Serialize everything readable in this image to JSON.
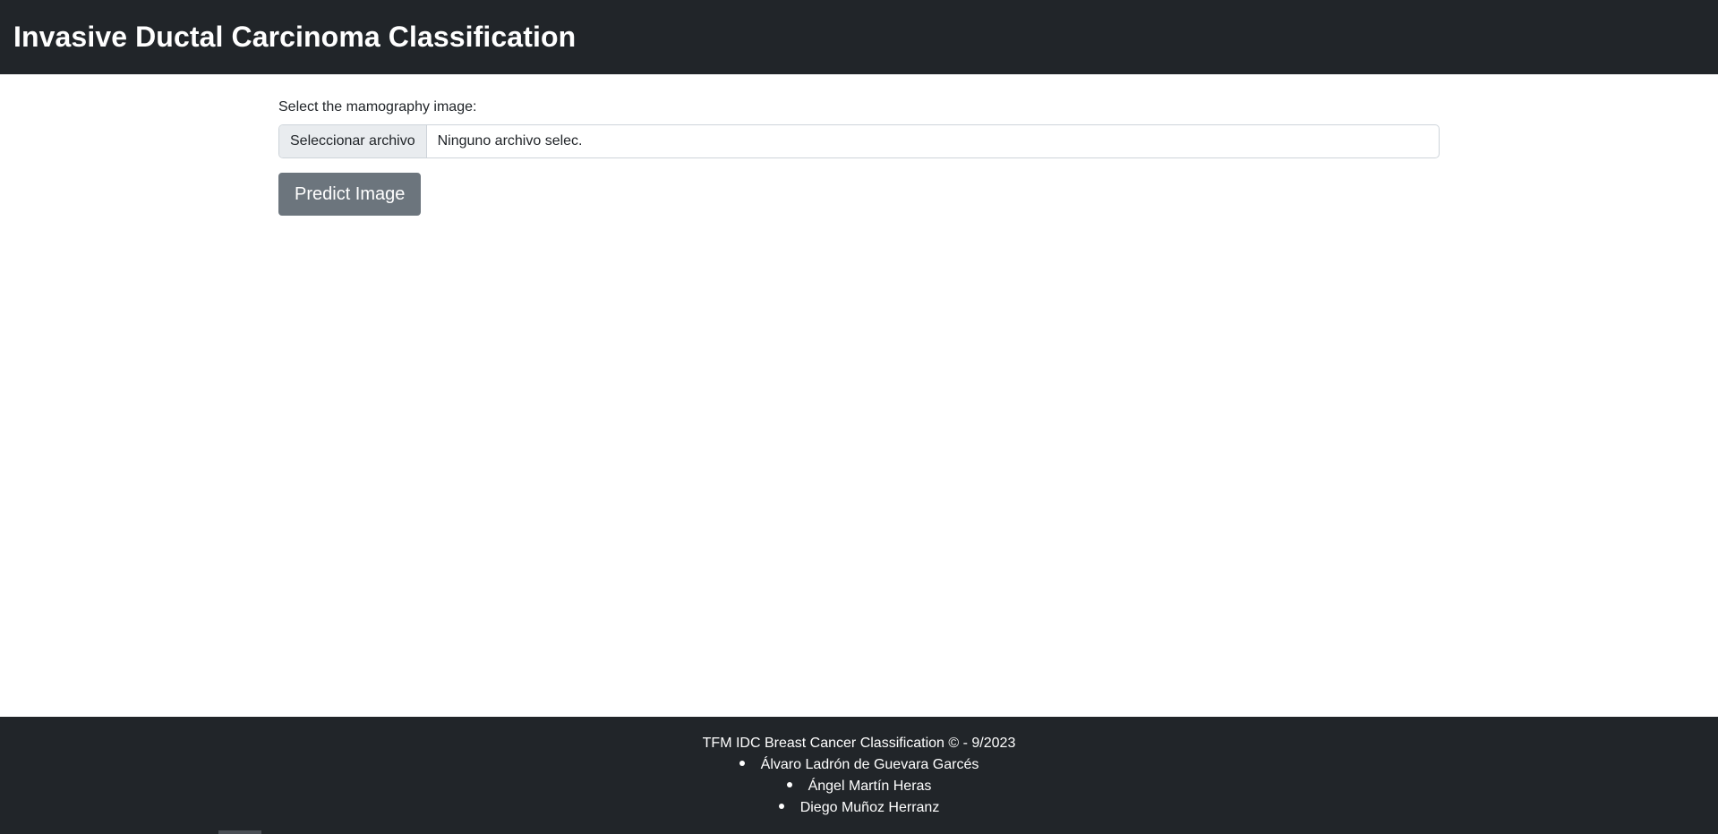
{
  "header": {
    "title": "Invasive Ductal Carcinoma Classification"
  },
  "form": {
    "label": "Select the mamography image:",
    "file_button_label": "Seleccionar archivo",
    "file_status": "Ninguno archivo selec.",
    "predict_button_label": "Predict Image"
  },
  "footer": {
    "copyright": "TFM IDC Breast Cancer Classification © - 9/2023",
    "authors": [
      "Álvaro Ladrón de Guevara Garcés",
      "Ángel Martín Heras",
      "Diego Muñoz Herranz"
    ]
  },
  "colors": {
    "header_bg": "#212529",
    "footer_bg": "#212529",
    "button_bg": "#6c757d",
    "file_button_bg": "#e9ecef"
  }
}
